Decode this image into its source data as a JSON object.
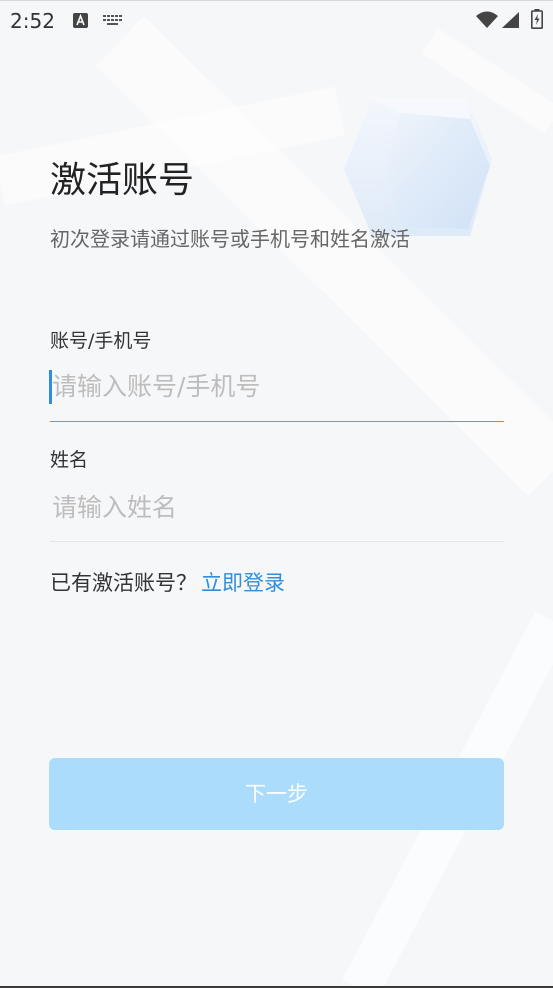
{
  "status_bar": {
    "time": "2:52",
    "left_icons": [
      "a-icon",
      "keyboard-icon"
    ],
    "right_icons": [
      "wifi-icon",
      "signal-icon",
      "battery-charging-icon"
    ]
  },
  "header": {
    "title": "激活账号",
    "subtitle": "初次登录请通过账号或手机号和姓名激活"
  },
  "form": {
    "account": {
      "label": "账号/手机号",
      "value": "",
      "placeholder": "请输入账号/手机号",
      "focused": true
    },
    "name": {
      "label": "姓名",
      "value": "",
      "placeholder": "请输入姓名",
      "focused": false
    }
  },
  "login_prompt": {
    "text": "已有激活账号？",
    "link": "立即登录"
  },
  "next_button": {
    "label": "下一步",
    "enabled": false
  },
  "colors": {
    "accent": "#2f8fdd",
    "underline_active": "#4aa3e8",
    "underline_idle": "#e6e6e6",
    "button_bg": "#abdcfb",
    "page_bg": "#f6f7f9"
  }
}
